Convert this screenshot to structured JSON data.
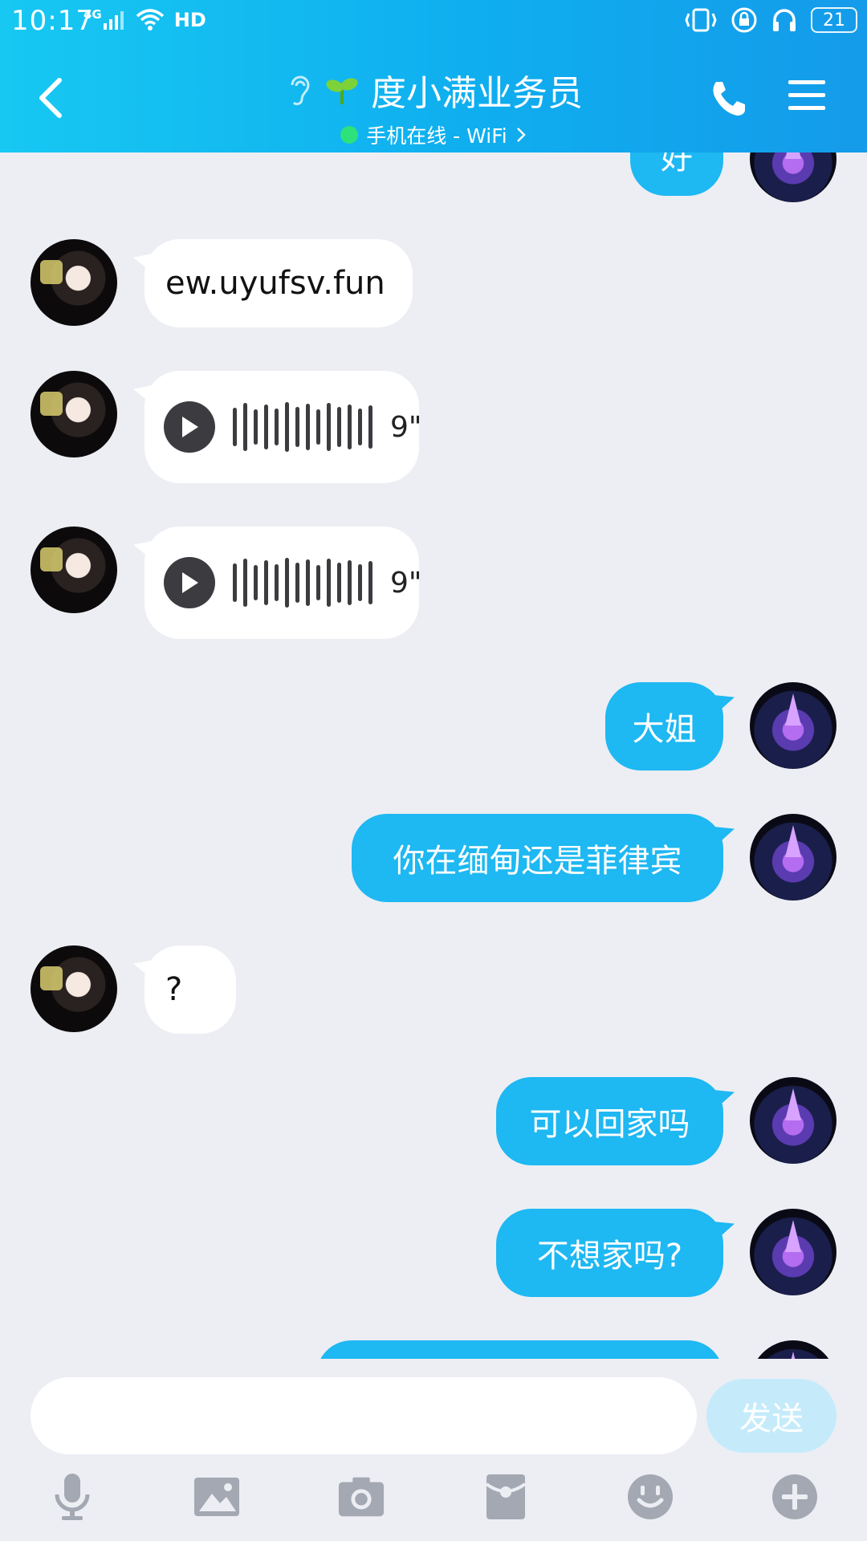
{
  "status_bar": {
    "time": "10:17",
    "network": "4G",
    "hd": "HD",
    "battery": "21"
  },
  "header": {
    "title": "度小满业务员",
    "online_status": "手机在线 - WiFi",
    "icons": [
      "back-arrow-icon",
      "ear-icon",
      "sprout-icon",
      "phone-icon",
      "menu-icon"
    ]
  },
  "messages": [
    {
      "side": "out",
      "text": "好",
      "partially_visible": true
    },
    {
      "side": "in",
      "text": "ew.uyufsv.fun"
    },
    {
      "side": "in",
      "type": "voice",
      "duration": "9\""
    },
    {
      "side": "in",
      "type": "voice",
      "duration": "9\""
    },
    {
      "side": "out",
      "text": "大姐"
    },
    {
      "side": "out",
      "text": "你在缅甸还是菲律宾"
    },
    {
      "side": "in",
      "text": "?"
    },
    {
      "side": "out",
      "text": "可以回家吗"
    },
    {
      "side": "out",
      "text": "不想家吗?"
    },
    {
      "side": "out",
      "text": "",
      "partially_visible": true
    }
  ],
  "composer": {
    "input_value": "",
    "input_placeholder": "",
    "send_label": "发送"
  },
  "toolbar": {
    "items": [
      "microphone-icon",
      "image-icon",
      "camera-icon",
      "red-packet-icon",
      "emoji-icon",
      "plus-icon"
    ]
  },
  "colors": {
    "header_start": "#17C8F2",
    "header_end": "#149BEA",
    "outgoing_bubble": "#1EB8F2",
    "incoming_bubble": "#FFFFFF",
    "chat_background": "#ECEEF4",
    "send_button_disabled": "#C5EBFB",
    "online_dot": "#2DE27A"
  }
}
